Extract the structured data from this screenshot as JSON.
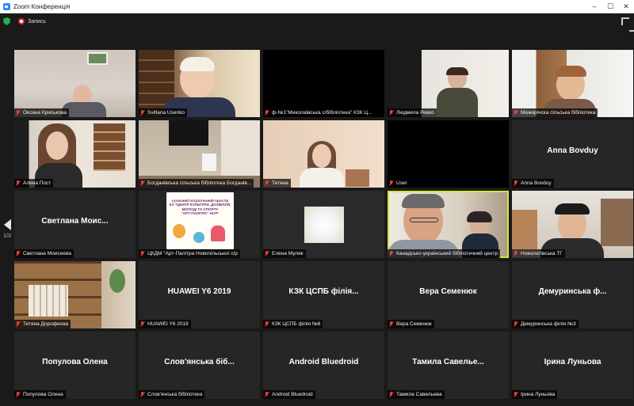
{
  "window": {
    "title": "Zoom Конференція",
    "minimize": "–",
    "maximize": "☐",
    "close": "✕"
  },
  "status": {
    "recording_label": "Запись"
  },
  "pager": {
    "page": "1/3"
  },
  "colors": {
    "active_speaker": "#d6e33a",
    "mic_muted": "#e84040",
    "record": "#e02828",
    "shield": "#23b14d"
  },
  "tiles": [
    {
      "label": "Оксана Криськова",
      "big": ""
    },
    {
      "label": "Svitlana Usenko",
      "big": ""
    },
    {
      "label": "ф-№1\"Миколаївська с/бібліотека\" КЗК Ц...",
      "big": ""
    },
    {
      "label": "Людмила Ревко",
      "big": ""
    },
    {
      "label": "Межирічска сільська бібліотека",
      "big": ""
    },
    {
      "label": "Алена Пост",
      "big": ""
    },
    {
      "label": "Богданівська сільська бібліотека Богданів...",
      "big": ""
    },
    {
      "label": "Тетяна",
      "big": ""
    },
    {
      "label": "User",
      "big": ""
    },
    {
      "label": "Anna Bovduy",
      "big": "Anna Bovduy"
    },
    {
      "label": "Светлана Моисеева",
      "big": "Светлана Моис..."
    },
    {
      "label": "ЦКДМ \"Арт-Палітра Новопільської с/р",
      "big": ""
    },
    {
      "label": "Елена Муляк",
      "big": ""
    },
    {
      "label": "Канадсько-український бібліотечний центр",
      "big": ""
    },
    {
      "label": "Новолатівська ТГ",
      "big": ""
    },
    {
      "label": "Тетяна Дорофеєва",
      "big": ""
    },
    {
      "label": "HUAWEI Y6 2019",
      "big": "HUAWEI Y6 2019"
    },
    {
      "label": "КЗК ЦСПБ філія №6",
      "big": "КЗК ЦСПБ філія..."
    },
    {
      "label": "Вера Семенюк",
      "big": "Вера Семенюк"
    },
    {
      "label": "Демуринська філія №3",
      "big": "Демуринська ф..."
    },
    {
      "label": "Популова Олена",
      "big": "Популова Олена"
    },
    {
      "label": "Слов'янська бібліотека",
      "big": "Слов'янська біб..."
    },
    {
      "label": "Android Bluedroid",
      "big": "Android Bluedroid"
    },
    {
      "label": "Тамила Савельева",
      "big": "Тамила Савелье..."
    },
    {
      "label": "Ірина Луньова",
      "big": "Ірина Луньова"
    }
  ],
  "poster": {
    "line1": "сучасний патріотичний простір",
    "line2": "КЗ \"ЦЕНТР КУЛЬТУРИ, ДОЗВІЛЛЯ,",
    "line3": "МОЛОДІ ТА СПОРТУ",
    "line4": "\"АРТ-ПАЛІТРА\" НСР\""
  }
}
